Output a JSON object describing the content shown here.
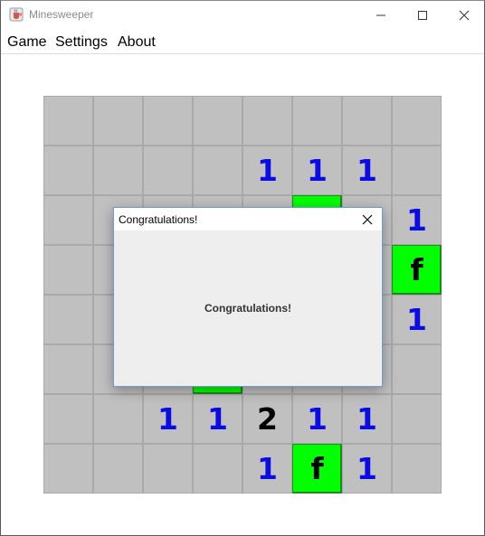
{
  "window": {
    "title": "Minesweeper",
    "app_icon": "java-cup-icon",
    "controls": [
      "minimize-icon",
      "maximize-icon",
      "close-icon"
    ]
  },
  "menu": {
    "items": [
      "Game",
      "Settings",
      "About"
    ]
  },
  "board": {
    "rows": 8,
    "cols": 8,
    "colors": {
      "hidden": "#c0c0c0",
      "revealed_safe": "#00ff00",
      "number_1": "#0b0be6",
      "number_2": "#000000"
    },
    "cells": [
      [
        "",
        "",
        "",
        "",
        "",
        "",
        "",
        ""
      ],
      [
        "",
        "",
        "",
        "",
        "1",
        "1",
        "1",
        ""
      ],
      [
        "",
        "",
        "",
        "",
        "",
        "G",
        "",
        "1"
      ],
      [
        "",
        "",
        "",
        "",
        "",
        "",
        "",
        "f"
      ],
      [
        "",
        "",
        "",
        "",
        "",
        "",
        "",
        "1"
      ],
      [
        "",
        "",
        "",
        "G",
        "",
        "",
        "",
        ""
      ],
      [
        "",
        "",
        "1",
        "1",
        "2",
        "1",
        "1",
        ""
      ],
      [
        "",
        "",
        "",
        "",
        "1",
        "f",
        "1",
        ""
      ]
    ]
  },
  "dialog": {
    "title": "Congratulations!",
    "message": "Congratulations!",
    "close_icon": "close-icon"
  }
}
